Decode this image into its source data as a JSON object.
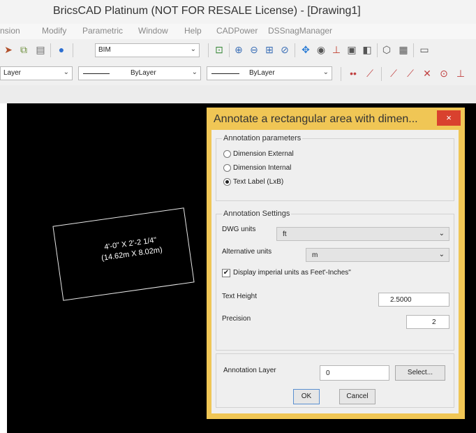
{
  "window": {
    "title": "BricsCAD Platinum (NOT FOR RESALE License) - [Drawing1]"
  },
  "menu": [
    "nsion",
    "Modify",
    "Parametric",
    "Window",
    "Help",
    "CADPower",
    "DSSnagManager"
  ],
  "toolbar": {
    "style_value": "BIM",
    "layer_value": "Layer",
    "linetype_value": "ByLayer",
    "lineweight_value": "ByLayer"
  },
  "canvas": {
    "annotation_line1": "4'-0\" X 2'-2 1/4\"",
    "annotation_line2": "(14.62m X 8.02m)"
  },
  "dialog": {
    "title": "Annotate a rectangular area with dimen...",
    "close_symbol": "×",
    "params_group": "Annotation parameters",
    "options": [
      "Dimension External",
      "Dimension Internal",
      "Text Label (LxB)"
    ],
    "selected_option": 2,
    "settings_group": "Annotation Settings",
    "dwg_units_label": "DWG units",
    "dwg_units_value": "ft",
    "alt_units_label": "Alternative units",
    "alt_units_value": "m",
    "display_imperial_label": "Display imperial units as Feet'-Inches\"",
    "display_imperial_checked": true,
    "text_height_label": "Text Height",
    "text_height_value": "2.5000",
    "precision_label": "Precision",
    "precision_value": "2",
    "layer_label": "Annotation Layer",
    "layer_value": "0",
    "select_button": "Select...",
    "ok_button": "OK",
    "cancel_button": "Cancel",
    "check_glyph": "✔"
  },
  "colors": {
    "dialog_frame": "#f0c655",
    "close_button": "#d9412e",
    "canvas": "#000000"
  }
}
